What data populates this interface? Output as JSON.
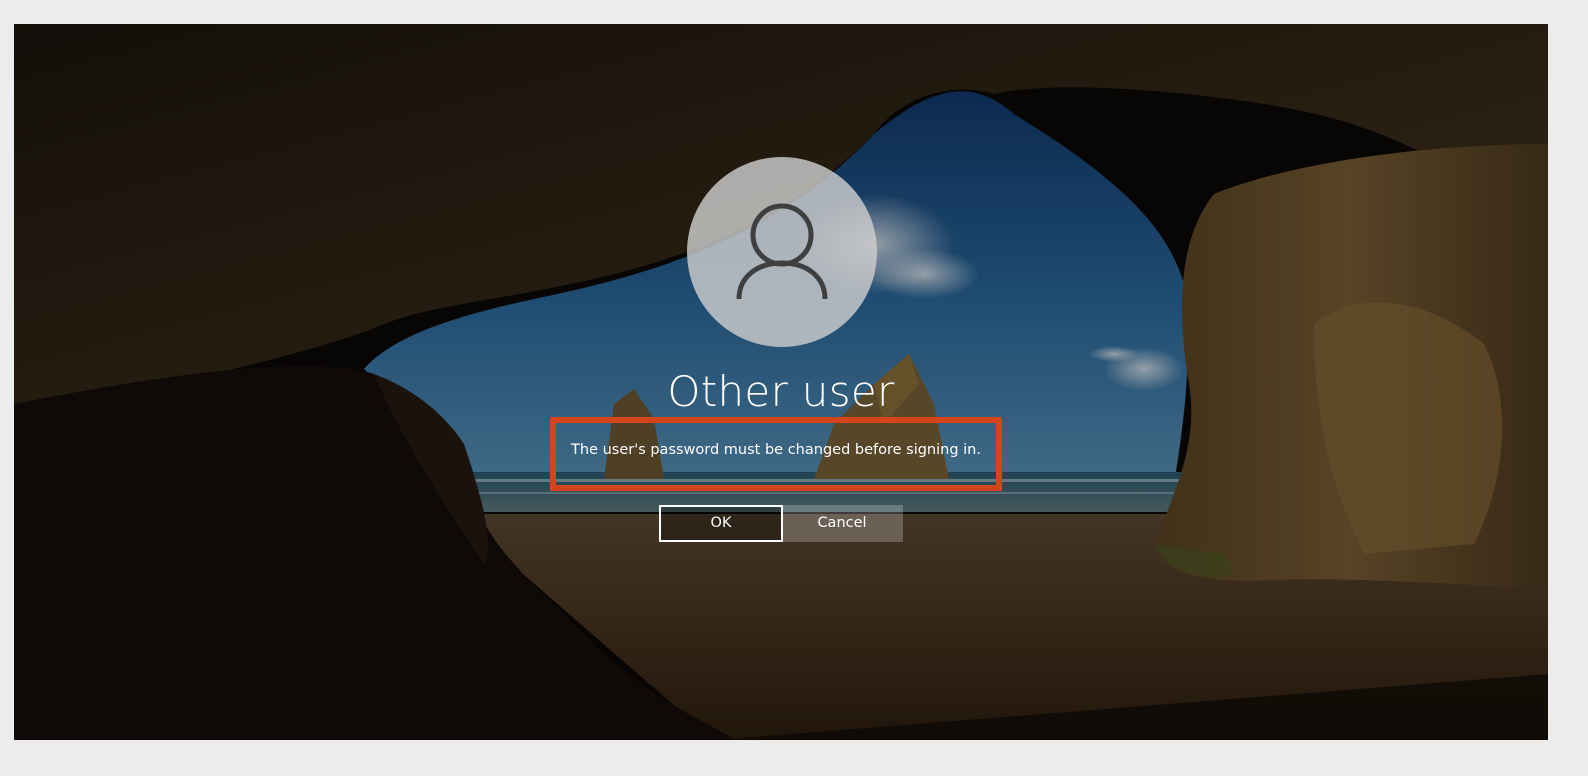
{
  "login": {
    "username": "Other user",
    "message": "The user's password must be changed before signing in.",
    "ok_label": "OK",
    "cancel_label": "Cancel",
    "highlight_color": "#d4451b"
  },
  "icons": {
    "avatar": "user-silhouette-icon"
  }
}
